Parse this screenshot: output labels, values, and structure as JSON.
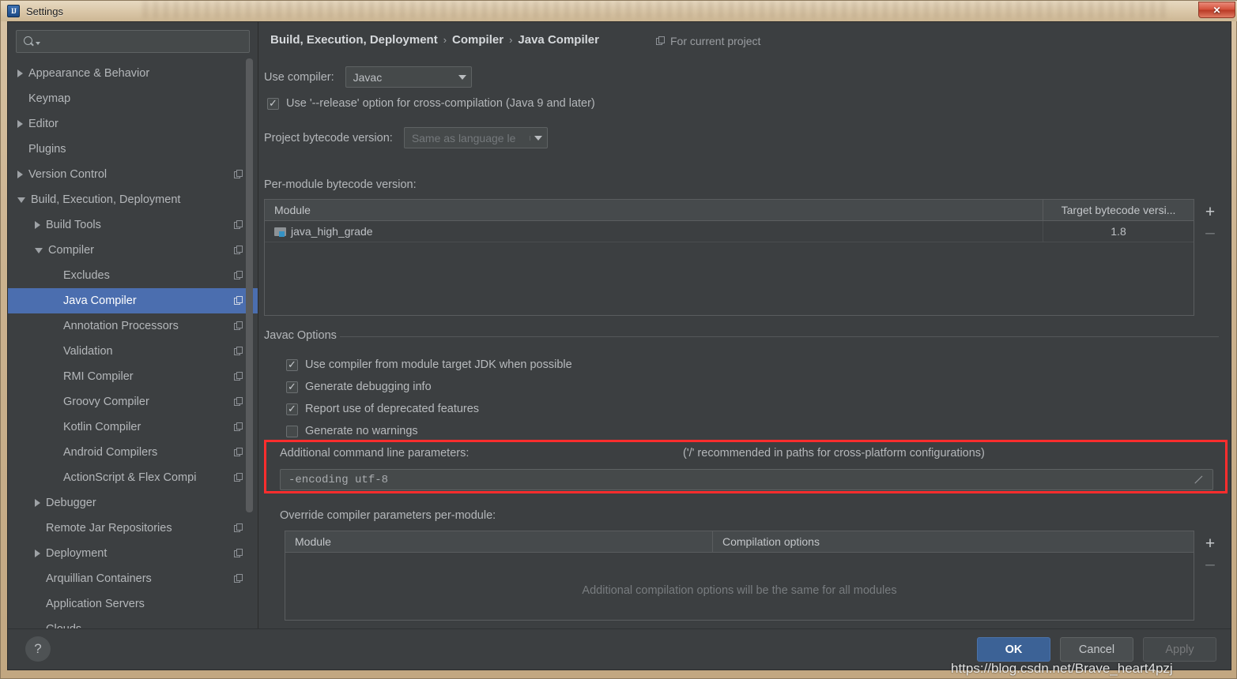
{
  "window": {
    "title": "Settings",
    "app_icon": "intellij-idea-icon",
    "close_label": "✕"
  },
  "sidebar": {
    "search": {
      "value": "",
      "placeholder": ""
    },
    "items": [
      {
        "label": "Appearance & Behavior",
        "indent": 0,
        "arrow": "collapsed",
        "badge": false,
        "selected": false
      },
      {
        "label": "Keymap",
        "indent": 0,
        "arrow": "none",
        "badge": false,
        "selected": false
      },
      {
        "label": "Editor",
        "indent": 0,
        "arrow": "collapsed",
        "badge": false,
        "selected": false
      },
      {
        "label": "Plugins",
        "indent": 0,
        "arrow": "none",
        "badge": false,
        "selected": false
      },
      {
        "label": "Version Control",
        "indent": 0,
        "arrow": "collapsed",
        "badge": true,
        "selected": false
      },
      {
        "label": "Build, Execution, Deployment",
        "indent": 0,
        "arrow": "expanded",
        "badge": false,
        "selected": false
      },
      {
        "label": "Build Tools",
        "indent": 1,
        "arrow": "collapsed",
        "badge": true,
        "selected": false
      },
      {
        "label": "Compiler",
        "indent": 1,
        "arrow": "expanded",
        "badge": true,
        "selected": false
      },
      {
        "label": "Excludes",
        "indent": 2,
        "arrow": "none",
        "badge": true,
        "selected": false
      },
      {
        "label": "Java Compiler",
        "indent": 2,
        "arrow": "none",
        "badge": true,
        "selected": true
      },
      {
        "label": "Annotation Processors",
        "indent": 2,
        "arrow": "none",
        "badge": true,
        "selected": false
      },
      {
        "label": "Validation",
        "indent": 2,
        "arrow": "none",
        "badge": true,
        "selected": false
      },
      {
        "label": "RMI Compiler",
        "indent": 2,
        "arrow": "none",
        "badge": true,
        "selected": false
      },
      {
        "label": "Groovy Compiler",
        "indent": 2,
        "arrow": "none",
        "badge": true,
        "selected": false
      },
      {
        "label": "Kotlin Compiler",
        "indent": 2,
        "arrow": "none",
        "badge": true,
        "selected": false
      },
      {
        "label": "Android Compilers",
        "indent": 2,
        "arrow": "none",
        "badge": true,
        "selected": false
      },
      {
        "label": "ActionScript & Flex Compi",
        "indent": 2,
        "arrow": "none",
        "badge": true,
        "selected": false
      },
      {
        "label": "Debugger",
        "indent": 1,
        "arrow": "collapsed",
        "badge": false,
        "selected": false
      },
      {
        "label": "Remote Jar Repositories",
        "indent": 1,
        "arrow": "none",
        "badge": true,
        "selected": false
      },
      {
        "label": "Deployment",
        "indent": 1,
        "arrow": "collapsed",
        "badge": true,
        "selected": false
      },
      {
        "label": "Arquillian Containers",
        "indent": 1,
        "arrow": "none",
        "badge": true,
        "selected": false
      },
      {
        "label": "Application Servers",
        "indent": 1,
        "arrow": "none",
        "badge": false,
        "selected": false
      },
      {
        "label": "Clouds",
        "indent": 1,
        "arrow": "none",
        "badge": false,
        "selected": false
      }
    ]
  },
  "content": {
    "breadcrumb": [
      "Build, Execution, Deployment",
      "Compiler",
      "Java Compiler"
    ],
    "breadcrumb_separator": "›",
    "for_current_project": "For current project",
    "use_compiler_label": "Use compiler:",
    "use_compiler_value": "Javac",
    "release_option_label": "Use '--release' option for cross-compilation (Java 9 and later)",
    "release_option_checked": true,
    "project_bytecode_label": "Project bytecode version:",
    "project_bytecode_value": "Same as language le",
    "per_module_label": "Per-module bytecode version:",
    "module_table": {
      "columns": [
        "Module",
        "Target bytecode versi..."
      ],
      "rows": [
        {
          "module": "java_high_grade",
          "target": "1.8"
        }
      ],
      "add_label": "+",
      "remove_label": "–"
    },
    "javac_options_title": "Javac Options",
    "javac_checkboxes": [
      {
        "label": "Use compiler from module target JDK when possible",
        "checked": true
      },
      {
        "label": "Generate debugging info",
        "checked": true
      },
      {
        "label": "Report use of deprecated features",
        "checked": true
      },
      {
        "label": "Generate no warnings",
        "checked": false
      }
    ],
    "additional_params_label": "Additional command line parameters:",
    "additional_params_hint": "('/' recommended in paths for cross-platform configurations)",
    "additional_params_value": "-encoding utf-8",
    "override_label": "Override compiler parameters per-module:",
    "override_table": {
      "columns": [
        "Module",
        "Compilation options"
      ],
      "empty_text": "Additional compilation options will be the same for all modules",
      "add_label": "+",
      "remove_label": "–"
    }
  },
  "footer": {
    "help_label": "?",
    "ok_label": "OK",
    "cancel_label": "Cancel",
    "apply_label": "Apply"
  },
  "watermark": "https://blog.csdn.net/Brave_heart4pzj",
  "colors": {
    "accent_selection": "#4b6eaf",
    "highlight_red": "#ff2d2d",
    "panel_bg": "#3c3f41",
    "ok_button": "#3c6296"
  }
}
